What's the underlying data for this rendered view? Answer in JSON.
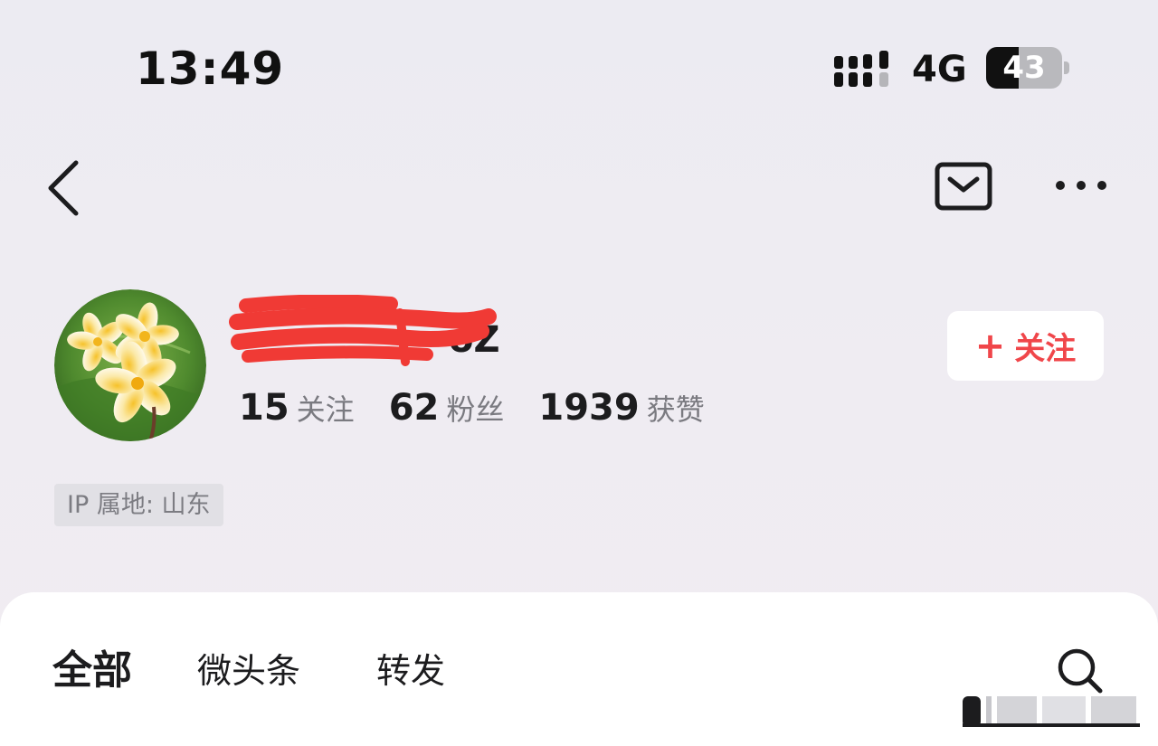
{
  "status_bar": {
    "time": "13:49",
    "network": "4G",
    "battery": "43",
    "battery_level": 0.43
  },
  "header": {
    "back_icon": "chevron-left-icon",
    "mail_icon": "envelope-icon",
    "more_icon": "ellipsis-icon"
  },
  "profile": {
    "username_visible": "oZ",
    "avatar": "frangipani-flower-avatar",
    "stats": [
      {
        "value": "15",
        "label": "关注"
      },
      {
        "value": "62",
        "label": "粉丝"
      },
      {
        "value": "1939",
        "label": "获赞"
      }
    ],
    "follow_button": {
      "plus": "+",
      "label": "关注"
    },
    "ip_location": "IP 属地: 山东"
  },
  "tabs": [
    {
      "label": "全部",
      "active": true
    },
    {
      "label": "微头条",
      "active": false
    },
    {
      "label": "转发",
      "active": false
    }
  ],
  "search_icon": "search-icon",
  "colors": {
    "accent_red": "#f0464a",
    "background": "#eeecf2",
    "text_primary": "#1c1c1e",
    "text_secondary": "#7a7a80"
  }
}
